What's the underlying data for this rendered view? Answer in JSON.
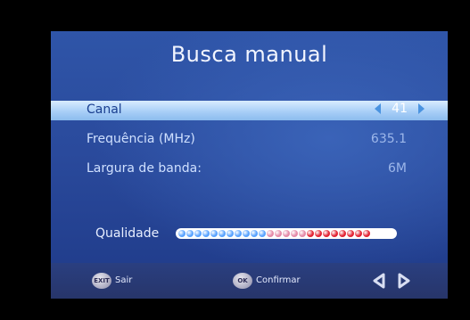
{
  "title": "Busca manual",
  "rows": [
    {
      "label": "Canal",
      "value": "41"
    },
    {
      "label": "Frequência (MHz)",
      "value": "635.1"
    },
    {
      "label": "Largura de banda:",
      "value": "6M"
    }
  ],
  "quality": {
    "label": "Qualidade",
    "level": 1.0,
    "segments": 24
  },
  "footer": {
    "exit_key": "EXIT",
    "exit_label": "Sair",
    "ok_key": "OK",
    "ok_label": "Confirmar"
  },
  "colors": {
    "background": "#2a4a9c",
    "highlight": "#a9cff7",
    "quality_blue": "#5aa3ff",
    "quality_pink": "#e58aa8",
    "quality_red": "#e32333"
  },
  "icons": [
    "arrow-left-icon",
    "arrow-right-icon",
    "nav-left-icon",
    "nav-right-icon"
  ]
}
